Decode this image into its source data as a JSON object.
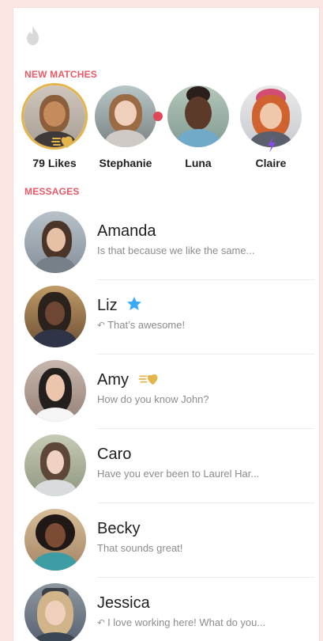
{
  "header": {
    "logo_icon": "flame-icon"
  },
  "new_matches": {
    "title": "NEW MATCHES",
    "items": [
      {
        "label": "79 Likes",
        "badge": "gold-icon"
      },
      {
        "label": "Stephanie",
        "badge": "red-dot"
      },
      {
        "label": "Luna",
        "badge": null
      },
      {
        "label": "Claire",
        "badge": "lightning-icon"
      }
    ]
  },
  "messages": {
    "title": "MESSAGES",
    "items": [
      {
        "name": "Amanda",
        "preview": "Is that because we like the same...",
        "reply": false,
        "badge": null
      },
      {
        "name": "Liz",
        "preview": "That’s awesome!",
        "reply": true,
        "badge": "star-icon"
      },
      {
        "name": "Amy",
        "preview": "How do you know John?",
        "reply": false,
        "badge": "gold-icon"
      },
      {
        "name": "Caro",
        "preview": "Have you ever been to Laurel Har...",
        "reply": false,
        "badge": null
      },
      {
        "name": "Becky",
        "preview": "That sounds great!",
        "reply": false,
        "badge": null
      },
      {
        "name": "Jessica",
        "preview": "I love working here! What do you...",
        "reply": true,
        "badge": null
      }
    ]
  },
  "colors": {
    "accent": "#e85a67",
    "gold": "#e3b54a",
    "blue_star": "#39a8ff",
    "red_dot": "#e0485a",
    "background": "#fbe6e4"
  }
}
